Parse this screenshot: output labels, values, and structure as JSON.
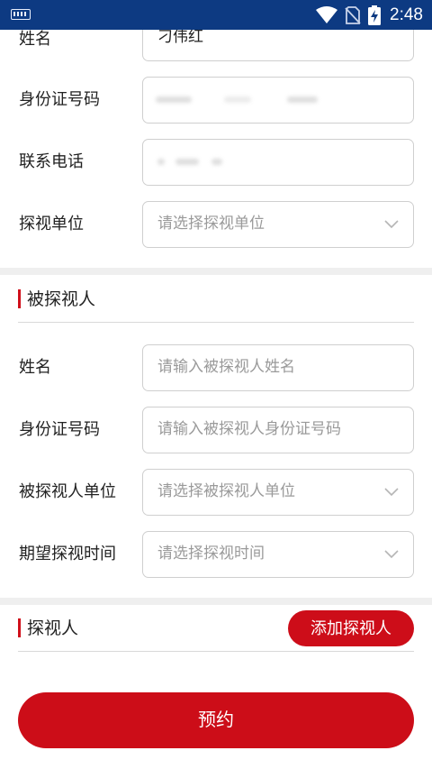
{
  "status_bar": {
    "time": "2:48",
    "icons": [
      "keyboard-icon",
      "wifi-icon",
      "no-sim-icon",
      "battery-charging-icon"
    ],
    "background": "#0d3a82"
  },
  "visitor": {
    "name_label": "姓名",
    "name_value": "刁伟红",
    "id_label": "身份证号码",
    "phone_label": "联系电话",
    "unit_label": "探视单位",
    "unit_placeholder": "请选择探视单位"
  },
  "visited": {
    "section_title": "被探视人",
    "name_label": "姓名",
    "name_placeholder": "请输入被探视人姓名",
    "id_label": "身份证号码",
    "id_placeholder": "请输入被探视人身份证号码",
    "unit_label": "被探视人单位",
    "unit_placeholder": "请选择被探视人单位",
    "time_label": "期望探视时间",
    "time_placeholder": "请选择探视时间"
  },
  "visitors_section": {
    "section_title": "探视人",
    "add_button": "添加探视人"
  },
  "submit_button": "预约",
  "colors": {
    "accent_red": "#cc0d18",
    "border": "#cfcfcf",
    "placeholder": "#9a9a9a"
  }
}
